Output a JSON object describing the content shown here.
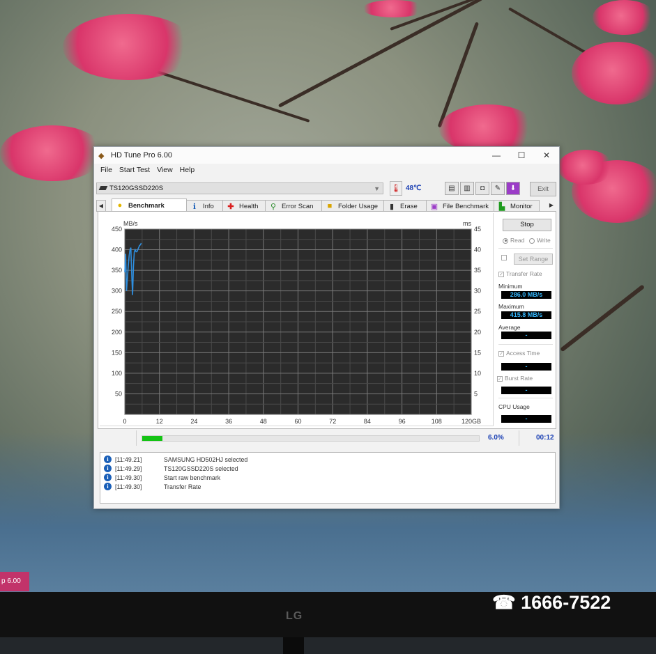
{
  "screen": {
    "taskbar_tab": "p 6.00",
    "monitor_brand": "LG",
    "overlay_phone": "☎ 1666-7522"
  },
  "window": {
    "title": "HD Tune Pro 6.00",
    "controls": {
      "minimize": "—",
      "maximize": "☐",
      "close": "✕"
    }
  },
  "menu": [
    "File",
    "Start Test",
    "View",
    "Help"
  ],
  "device": {
    "drive": "TS120GSSD220S",
    "temperature": "48℃",
    "tool_icons": [
      "copy-text-icon",
      "copy-all-icon",
      "screenshot-icon",
      "options-icon",
      "save-icon"
    ],
    "exit_label": "Exit"
  },
  "tabs": [
    {
      "label": "Benchmark",
      "icon": "bulb-icon",
      "active": true
    },
    {
      "label": "Info",
      "icon": "info-icon",
      "active": false
    },
    {
      "label": "Health",
      "icon": "health-cross-icon",
      "active": false
    },
    {
      "label": "Error Scan",
      "icon": "magnifier-icon",
      "active": false
    },
    {
      "label": "Folder Usage",
      "icon": "folder-icon",
      "active": false
    },
    {
      "label": "Erase",
      "icon": "trash-icon",
      "active": false
    },
    {
      "label": "File Benchmark",
      "icon": "file-benchmark-icon",
      "active": false
    },
    {
      "label": "Monitor",
      "icon": "monitor-icon",
      "active": false
    }
  ],
  "controls": {
    "stop_label": "Stop",
    "read_label": "Read",
    "write_label": "Write",
    "read_selected": true,
    "set_range_label": "Set Range",
    "transfer_rate_label": "Transfer Rate",
    "minimum_label": "Minimum",
    "minimum_value": "286.0 MB/s",
    "maximum_label": "Maximum",
    "maximum_value": "415.8 MB/s",
    "average_label": "Average",
    "average_value": "-",
    "access_time_label": "Access Time",
    "access_time_value": "-",
    "burst_rate_label": "Burst Rate",
    "burst_rate_value": "-",
    "cpu_usage_label": "CPU Usage",
    "cpu_usage_value": "-"
  },
  "progress": {
    "fraction": 0.06,
    "percent_label": "6.0%",
    "time": "00:12"
  },
  "log": [
    {
      "time": "[11:49.21]",
      "message": "SAMSUNG HD502HJ selected"
    },
    {
      "time": "[11:49.29]",
      "message": "TS120GSSD220S selected"
    },
    {
      "time": "[11:49.30]",
      "message": "Start raw benchmark"
    },
    {
      "time": "[11:49.30]",
      "message": "Transfer Rate"
    }
  ],
  "chart_data": {
    "type": "line",
    "title": "",
    "ylabel": "MB/s",
    "y2label": "ms",
    "xlabel": "",
    "x_tick_labels": [
      "0",
      "12",
      "24",
      "36",
      "48",
      "60",
      "72",
      "84",
      "96",
      "108",
      "120GB"
    ],
    "y_tick_labels": [
      "450",
      "400",
      "350",
      "300",
      "250",
      "200",
      "150",
      "100",
      "50"
    ],
    "y2_tick_labels": [
      "45",
      "40",
      "35",
      "30",
      "25",
      "20",
      "15",
      "10",
      "5"
    ],
    "xlim": [
      0,
      120
    ],
    "ylim": [
      0,
      450
    ],
    "y2lim": [
      0,
      45
    ],
    "grid": true,
    "series": [
      {
        "color": "#2e8fe0",
        "x": [
          0,
          0.3,
          0.6,
          0.9,
          1.2,
          1.5,
          1.8,
          2.1,
          2.4,
          2.7,
          3.0,
          3.3,
          3.6,
          3.9,
          4.2,
          4.5,
          4.8,
          5.1,
          5.4,
          5.7
        ],
        "y": [
          345,
          390,
          300,
          330,
          360,
          385,
          400,
          405,
          340,
          290,
          360,
          395,
          400,
          395,
          395,
          400,
          405,
          410,
          412,
          416
        ]
      }
    ]
  }
}
